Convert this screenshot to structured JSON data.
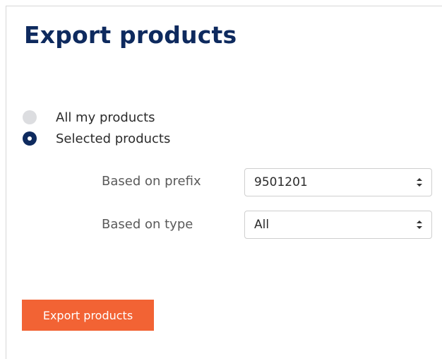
{
  "page": {
    "title": "Export products"
  },
  "scope": {
    "options": [
      {
        "label": "All my products",
        "selected": false
      },
      {
        "label": "Selected products",
        "selected": true
      }
    ]
  },
  "filters": {
    "prefix": {
      "label": "Based on prefix",
      "value": "9501201"
    },
    "type": {
      "label": "Based on type",
      "value": "All"
    }
  },
  "actions": {
    "export_label": "Export products"
  },
  "colors": {
    "title": "#0e2a5e",
    "radio_checked": "#0e2a5e",
    "radio_unchecked": "#dcdde0",
    "primary_button": "#f26334"
  },
  "icons": {
    "select_arrows": "up-down-chevrons-icon"
  }
}
